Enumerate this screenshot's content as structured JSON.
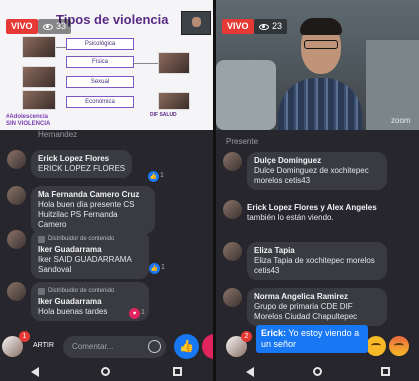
{
  "left": {
    "live": "VIVO",
    "viewers": "33",
    "slide": {
      "title": "Tipos de violencia",
      "boxes": [
        "Psicológica",
        "Física",
        "Sexual",
        "Económica"
      ],
      "hashtag_line1": "#Adolescencia",
      "hashtag_line2": "SIN VIOLENCIA",
      "logos": "DIF  SALUD"
    },
    "cut_author": "Hernandez",
    "comments": [
      {
        "author": "Erick Lopez Flores",
        "text": "ERICK LOPEZ FLORES",
        "reactions": "1"
      },
      {
        "author": "Ma Fernanda Camero Cruz",
        "text": "Hola buen día presente CS Huitzilac PS Fernanda Camero"
      },
      {
        "badge": "Distribuidor de contenido",
        "author": "Iker Guadarrama",
        "text": "Iker SAID GUADARRAMA Sandoval",
        "reactions": "1"
      },
      {
        "badge": "Distribuidor de contenido",
        "author": "Iker Guadarrama",
        "text": "Hola buenas tardes",
        "reactions": "1"
      }
    ],
    "share_label": "ARTIR",
    "comment_placeholder": "Comentar...",
    "notifications": "1"
  },
  "right": {
    "live": "VIVO",
    "viewers": "23",
    "zoom_watermark": "zoom",
    "cut_text": "Presente",
    "comments": [
      {
        "author": "Dulçe Domínguez",
        "text": "Dulce Dominguez de xochitepec morelos cetis43"
      },
      {
        "author_line": "Erick Lopez Flores y Alex Angeles",
        "text": "también lo están viendo."
      },
      {
        "author": "Eliza Tapia",
        "text": "Eliza Tapia de xochitepec morelos cetis43"
      },
      {
        "author": "Norma Angelica Ramirez",
        "text": "Grupo de primaria CDE DIF Morelos Ciudad Chapultepec"
      }
    ],
    "toast_author": "Erick:",
    "toast_text": "Yo estoy viendo a un señor",
    "notifications": "2"
  },
  "icons": [
    "eye-icon",
    "like-icon",
    "heart-icon",
    "emoji-icon",
    "back-icon",
    "home-icon",
    "recent-apps-icon"
  ]
}
